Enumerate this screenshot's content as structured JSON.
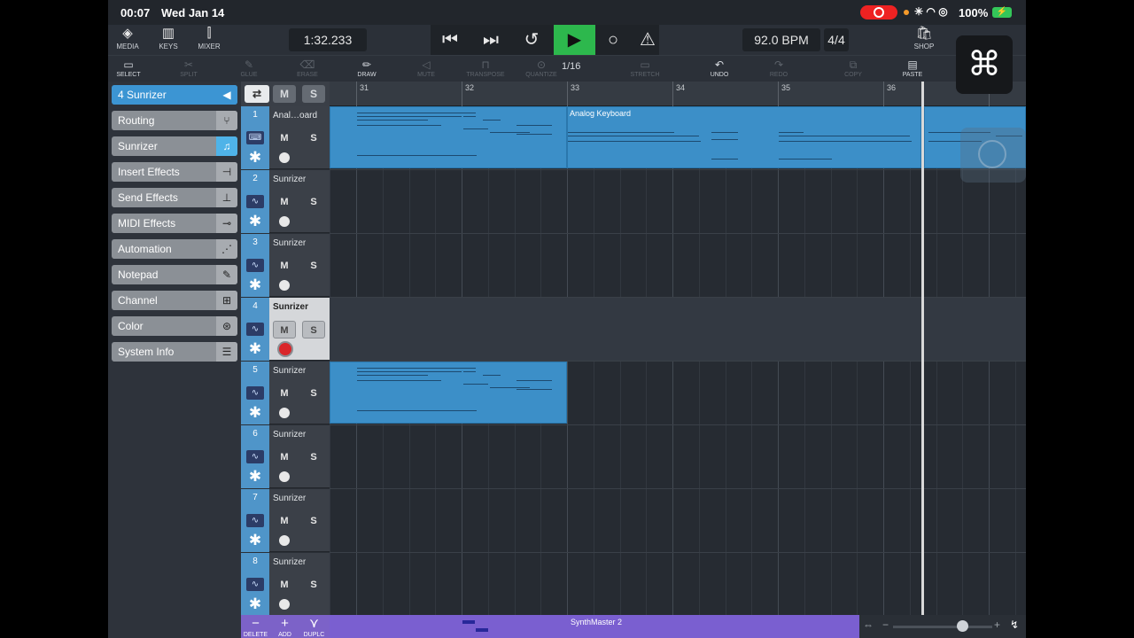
{
  "status": {
    "time": "00:07",
    "date": "Wed Jan 14",
    "battery": "100%"
  },
  "toolbar": {
    "media": "MEDIA",
    "keys": "KEYS",
    "mixer": "MIXER",
    "position": "1:32.233",
    "tempo": "92.0 BPM",
    "signature": "4/4",
    "shop": "SHOP"
  },
  "tools": {
    "select": "SELECT",
    "split": "SPLIT",
    "glue": "GLUE",
    "erase": "ERASE",
    "draw": "DRAW",
    "mute": "MUTE",
    "transpose": "TRANSPOSE",
    "quantize": "QUANTIZE",
    "quant_value": "1/16",
    "stretch": "STRETCH",
    "undo": "UNDO",
    "redo": "REDO",
    "copy": "COPY",
    "paste": "PASTE"
  },
  "overlay": {
    "cmd_symbol": "⌘"
  },
  "inspector": {
    "title": "4  Sunrizer",
    "items": [
      {
        "label": "Routing"
      },
      {
        "label": "Sunrizer"
      },
      {
        "label": "Insert Effects"
      },
      {
        "label": "Send Effects"
      },
      {
        "label": "MIDI Effects"
      },
      {
        "label": "Automation"
      },
      {
        "label": "Notepad"
      },
      {
        "label": "Channel"
      },
      {
        "label": "Color"
      },
      {
        "label": "System Info"
      }
    ]
  },
  "header": {
    "mute": "M",
    "solo": "S"
  },
  "tracks": [
    {
      "num": "1",
      "name": "Anal…oard"
    },
    {
      "num": "2",
      "name": "Sunrizer"
    },
    {
      "num": "3",
      "name": "Sunrizer"
    },
    {
      "num": "4",
      "name": "Sunrizer"
    },
    {
      "num": "5",
      "name": "Sunrizer"
    },
    {
      "num": "6",
      "name": "Sunrizer"
    },
    {
      "num": "7",
      "name": "Sunrizer"
    },
    {
      "num": "8",
      "name": "Sunrizer"
    }
  ],
  "footer": {
    "delete": "DELETE",
    "add": "ADD",
    "duplicate": "DUPLC"
  },
  "ruler": {
    "bars": [
      "31",
      "32",
      "33",
      "34",
      "35",
      "36"
    ]
  },
  "regions": {
    "analog": "Analog Keyboard",
    "synthmaster": "SynthMaster 2"
  },
  "colors": {
    "play": "#2db84d",
    "region": "#3c8fc8",
    "inspector_active": "#3c95d3",
    "bottom_lane": "#7a5fd0"
  }
}
